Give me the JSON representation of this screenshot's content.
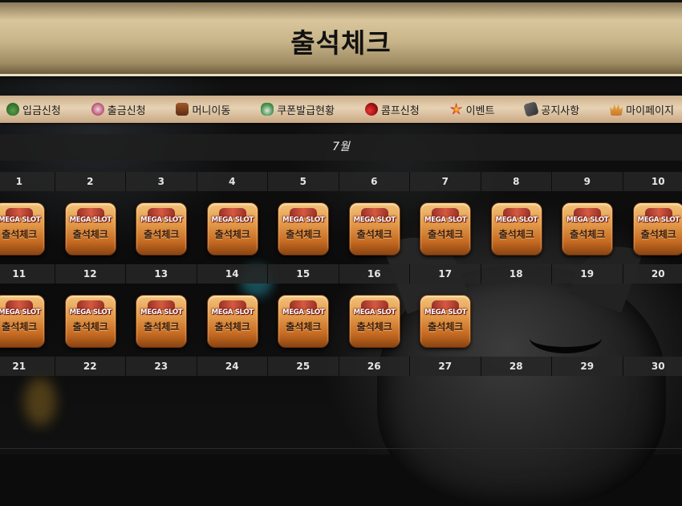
{
  "page": {
    "title": "출석체크"
  },
  "nav": {
    "items": [
      {
        "label": "입금신청",
        "icon": "money-bag-icon"
      },
      {
        "label": "출금신청",
        "icon": "coin-icon"
      },
      {
        "label": "머니이동",
        "icon": "chest-icon"
      },
      {
        "label": "쿠폰발급현황",
        "icon": "coupon-icon"
      },
      {
        "label": "콤프신청",
        "icon": "cherry-icon"
      },
      {
        "label": "이벤트",
        "icon": "star-icon"
      },
      {
        "label": "공지사항",
        "icon": "notice-icon"
      },
      {
        "label": "마이페이지",
        "icon": "crown-icon"
      }
    ]
  },
  "calendar": {
    "month": "7월",
    "weeks": [
      {
        "days": [
          "1",
          "2",
          "3",
          "4",
          "5",
          "6",
          "7",
          "8",
          "9",
          "10"
        ],
        "stamped": 10
      },
      {
        "days": [
          "11",
          "12",
          "13",
          "14",
          "15",
          "16",
          "17",
          "18",
          "19",
          "20"
        ],
        "stamped": 7
      },
      {
        "days": [
          "21",
          "22",
          "23",
          "24",
          "25",
          "26",
          "27",
          "28",
          "29",
          "30"
        ],
        "stamped": 0
      }
    ],
    "stamp": {
      "brand": "MEGA SLOT",
      "label": "출석체크"
    }
  },
  "colors": {
    "gold_header": "#c8b489",
    "nav_bar": "#e6d2b4",
    "stamp_orange": "#e39a4a"
  }
}
